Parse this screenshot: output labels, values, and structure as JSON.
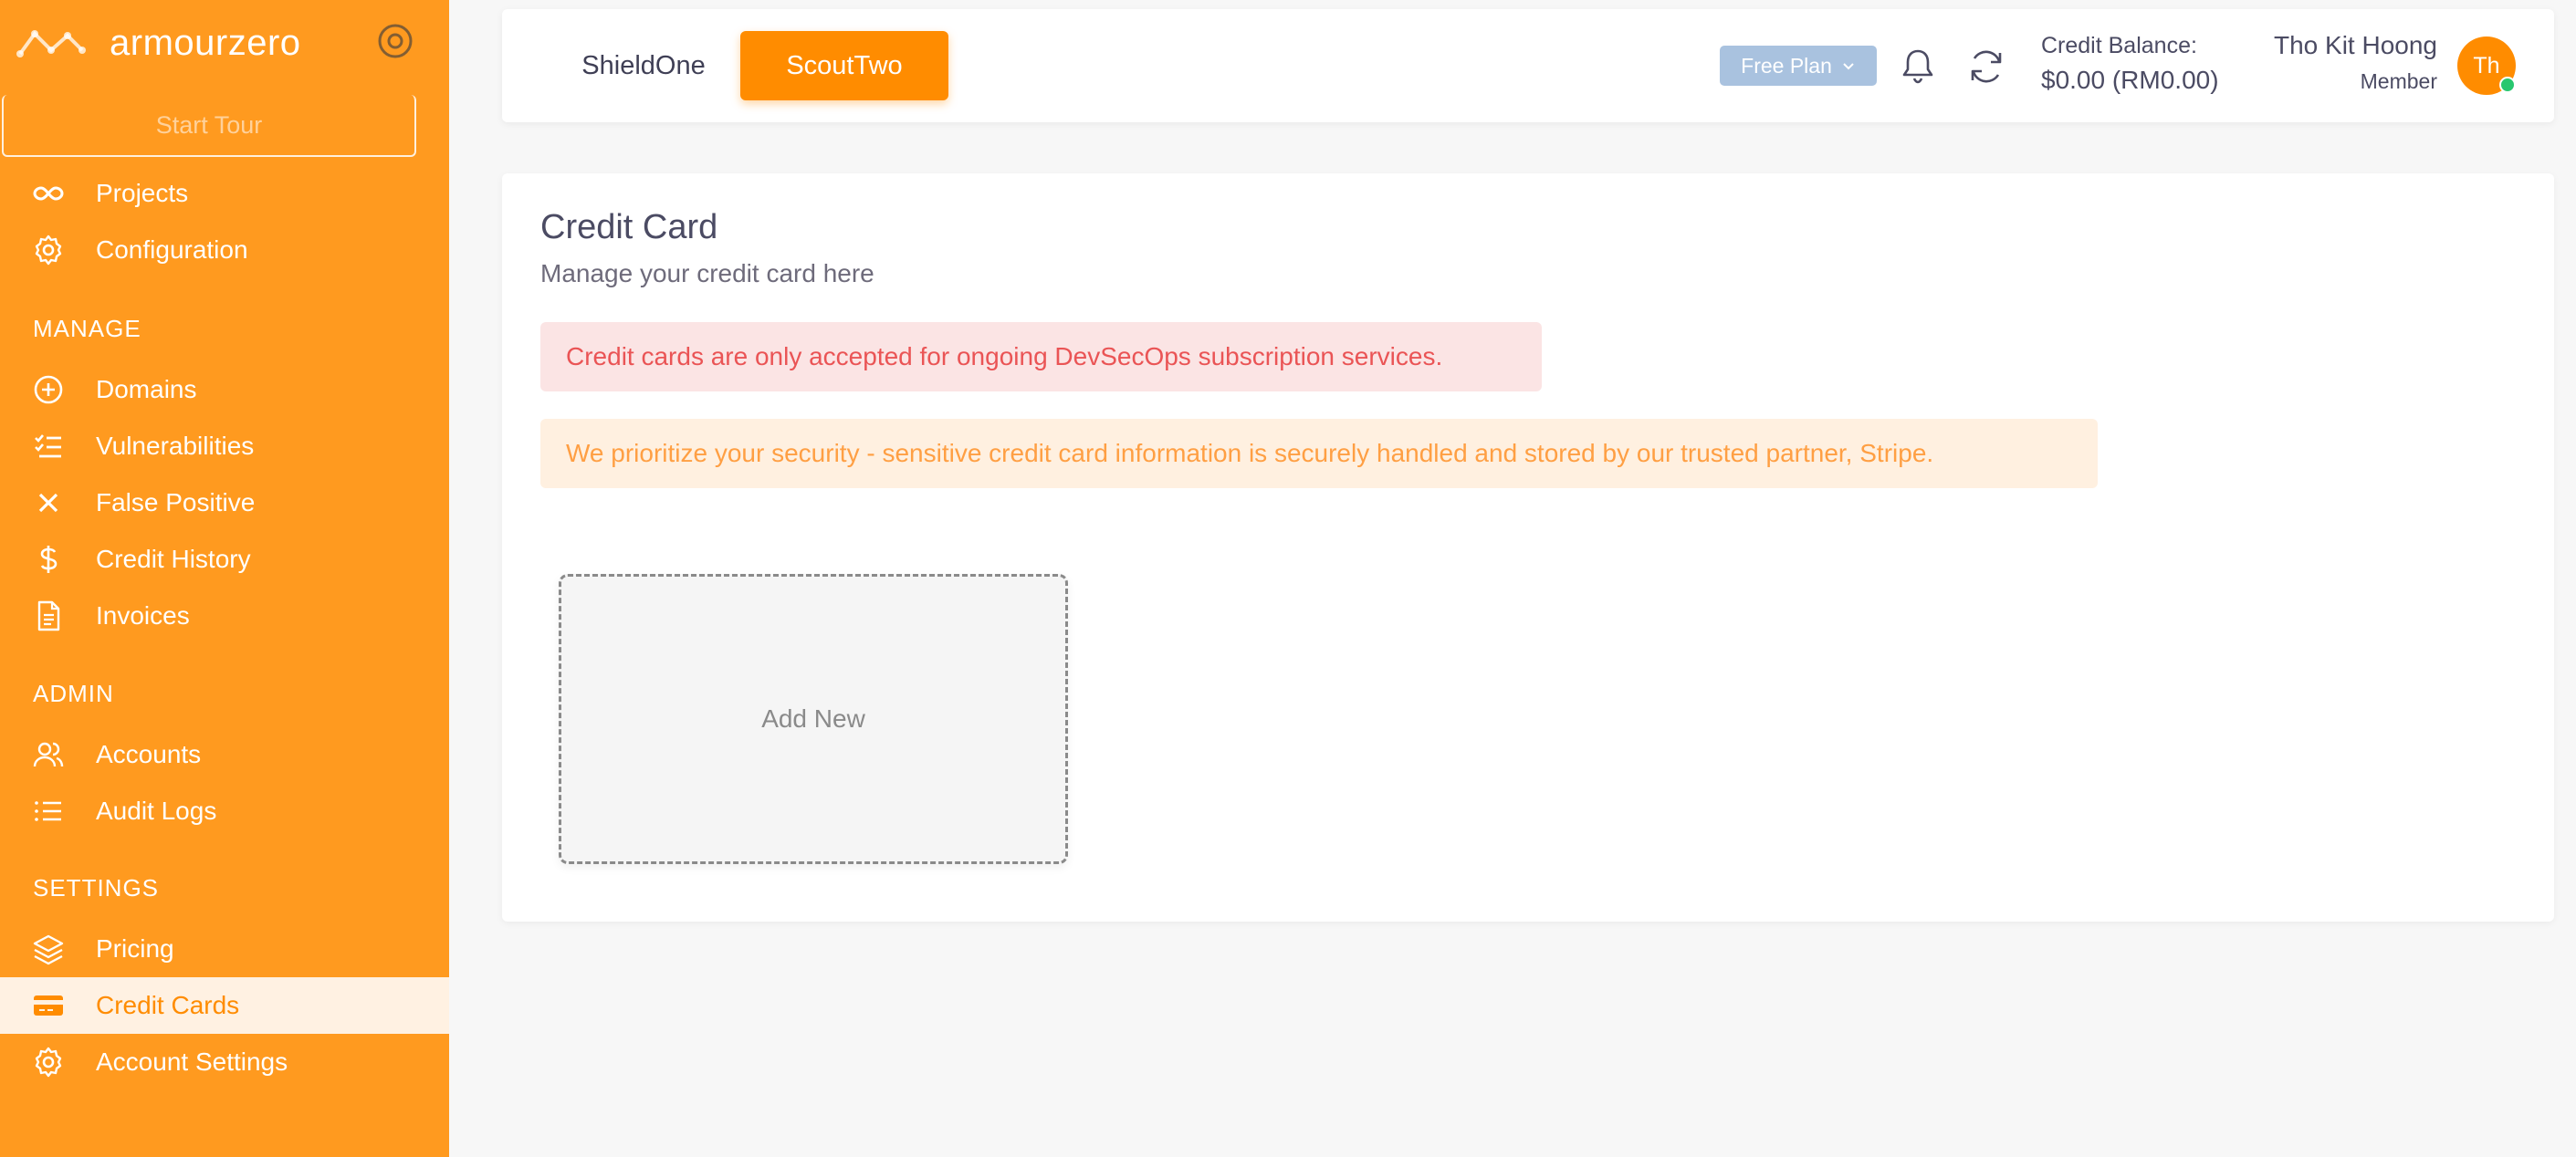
{
  "colors": {
    "accent": "#ff8c00",
    "sidebar": "#ff9a1f",
    "danger": "#ea5455",
    "warning": "#ff9f43",
    "online": "#28c76f"
  },
  "sidebar": {
    "brand": "armourzero",
    "start_tour": "Start Tour",
    "items_top": [
      {
        "label": "Projects",
        "icon": "infinity-icon"
      },
      {
        "label": "Configuration",
        "icon": "gear-icon"
      }
    ],
    "manage_heading": "MANAGE",
    "manage_items": [
      {
        "label": "Domains",
        "icon": "plus-circle-icon"
      },
      {
        "label": "Vulnerabilities",
        "icon": "checklist-icon"
      },
      {
        "label": "False Positive",
        "icon": "close-icon"
      },
      {
        "label": "Credit History",
        "icon": "dollar-icon"
      },
      {
        "label": "Invoices",
        "icon": "document-icon"
      }
    ],
    "admin_heading": "ADMIN",
    "admin_items": [
      {
        "label": "Accounts",
        "icon": "users-icon"
      },
      {
        "label": "Audit Logs",
        "icon": "list-icon"
      }
    ],
    "settings_heading": "SETTINGS",
    "settings_items": [
      {
        "label": "Pricing",
        "icon": "layers-icon"
      },
      {
        "label": "Credit Cards",
        "icon": "credit-card-icon",
        "active": true
      },
      {
        "label": "Account Settings",
        "icon": "gear-icon"
      }
    ]
  },
  "header": {
    "tabs": [
      {
        "label": "ShieldOne",
        "active": false
      },
      {
        "label": "ScoutTwo",
        "active": true
      }
    ],
    "plan_label": "Free Plan",
    "credit_balance_label": "Credit Balance:",
    "credit_balance_value": "$0.00 (RM0.00)",
    "user_name": "Tho Kit Hoong",
    "user_role": "Member",
    "avatar_initials": "Th"
  },
  "main": {
    "title": "Credit Card",
    "subtitle": "Manage your credit card here",
    "alert_danger": "Credit cards are only accepted for ongoing DevSecOps subscription services.",
    "alert_warning": "We prioritize your security - sensitive credit card information is securely handled and stored by our trusted partner, Stripe.",
    "add_new_label": "Add New"
  }
}
